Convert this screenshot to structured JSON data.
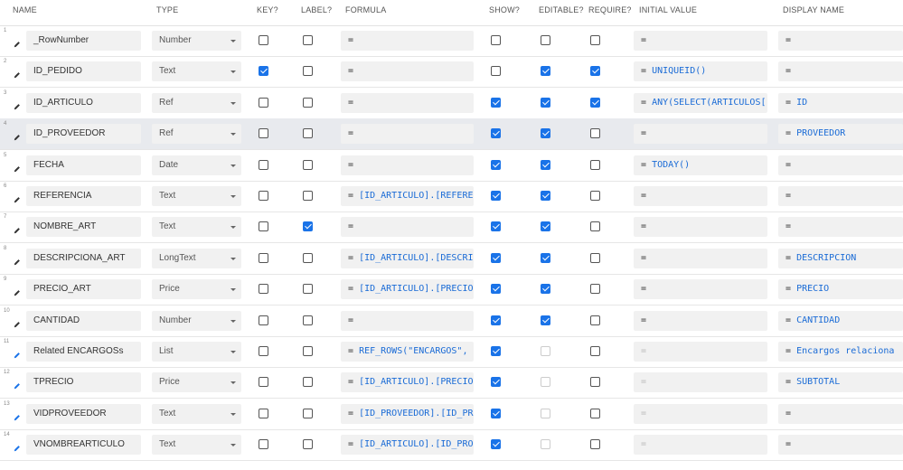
{
  "headers": {
    "name": "NAME",
    "type": "TYPE",
    "key": "KEY?",
    "label": "LABEL?",
    "formula": "FORMULA",
    "show": "SHOW?",
    "editable": "EDITABLE?",
    "require": "REQUIRE?",
    "initial": "INITIAL VALUE",
    "display": "DISPLAY NAME"
  },
  "colors": {
    "accent": "#1a73e8",
    "formula_text": "#1a6bd6",
    "highlight_row": "#e8eaee"
  },
  "rows": [
    {
      "num": "1",
      "name": "_RowNumber",
      "type": "Number",
      "key": false,
      "label": false,
      "formula": "",
      "show": false,
      "editable": false,
      "editable_disabled": false,
      "require": false,
      "initial": "",
      "initial_dim": false,
      "display": ""
    },
    {
      "num": "2",
      "name": "ID_PEDIDO",
      "type": "Text",
      "key": true,
      "label": false,
      "formula": "",
      "show": false,
      "editable": true,
      "editable_disabled": false,
      "require": true,
      "initial": "UNIQUEID()",
      "initial_dim": false,
      "display": ""
    },
    {
      "num": "3",
      "name": "ID_ARTICULO",
      "type": "Ref",
      "key": false,
      "label": false,
      "formula": "",
      "show": true,
      "editable": true,
      "editable_disabled": false,
      "require": true,
      "initial": "ANY(SELECT(ARTICULOS[",
      "initial_dim": false,
      "display": "ID"
    },
    {
      "num": "4",
      "name": "ID_PROVEEDOR",
      "type": "Ref",
      "key": false,
      "label": false,
      "formula": "",
      "show": true,
      "editable": true,
      "editable_disabled": false,
      "require": false,
      "initial": "",
      "initial_dim": false,
      "display": "PROVEEDOR"
    },
    {
      "num": "5",
      "name": "FECHA",
      "type": "Date",
      "key": false,
      "label": false,
      "formula": "",
      "show": true,
      "editable": true,
      "editable_disabled": false,
      "require": false,
      "initial": "TODAY()",
      "initial_dim": false,
      "display": ""
    },
    {
      "num": "6",
      "name": "REFERENCIA",
      "type": "Text",
      "key": false,
      "label": false,
      "formula": "[ID_ARTICULO].[REFERE",
      "show": true,
      "editable": true,
      "editable_disabled": false,
      "require": false,
      "initial": "",
      "initial_dim": false,
      "display": ""
    },
    {
      "num": "7",
      "name": "NOMBRE_ART",
      "type": "Text",
      "key": false,
      "label": true,
      "formula": "",
      "show": true,
      "editable": true,
      "editable_disabled": false,
      "require": false,
      "initial": "",
      "initial_dim": false,
      "display": ""
    },
    {
      "num": "8",
      "name": "DESCRIPCIONA_ART",
      "type": "LongText",
      "key": false,
      "label": false,
      "formula": "[ID_ARTICULO].[DESCRI",
      "show": true,
      "editable": true,
      "editable_disabled": false,
      "require": false,
      "initial": "",
      "initial_dim": false,
      "display": "DESCRIPCION"
    },
    {
      "num": "9",
      "name": "PRECIO_ART",
      "type": "Price",
      "key": false,
      "label": false,
      "formula": "[ID_ARTICULO].[PRECIO",
      "show": true,
      "editable": true,
      "editable_disabled": false,
      "require": false,
      "initial": "",
      "initial_dim": false,
      "display": "PRECIO"
    },
    {
      "num": "10",
      "name": "CANTIDAD",
      "type": "Number",
      "key": false,
      "label": false,
      "formula": "",
      "show": true,
      "editable": true,
      "editable_disabled": false,
      "require": false,
      "initial": "",
      "initial_dim": false,
      "display": "CANTIDAD"
    },
    {
      "num": "11",
      "name": "Related ENCARGOSs",
      "type": "List",
      "key": false,
      "label": false,
      "formula": "REF_ROWS(\"ENCARGOS\",",
      "show": true,
      "editable": false,
      "editable_disabled": true,
      "require": false,
      "initial": "",
      "initial_dim": true,
      "display": "Encargos relaciona"
    },
    {
      "num": "12",
      "name": "TPRECIO",
      "type": "Price",
      "key": false,
      "label": false,
      "formula": "[ID_ARTICULO].[PRECIO",
      "show": true,
      "editable": false,
      "editable_disabled": true,
      "require": false,
      "initial": "",
      "initial_dim": true,
      "display": "SUBTOTAL"
    },
    {
      "num": "13",
      "name": "VIDPROVEEDOR",
      "type": "Text",
      "key": false,
      "label": false,
      "formula": "[ID_PROVEEDOR].[ID_PR",
      "show": true,
      "editable": false,
      "editable_disabled": true,
      "require": false,
      "initial": "",
      "initial_dim": true,
      "display": ""
    },
    {
      "num": "14",
      "name": "VNOMBREARTICULO",
      "type": "Text",
      "key": false,
      "label": false,
      "formula": "[ID_ARTICULO].[ID_PRO",
      "show": true,
      "editable": false,
      "editable_disabled": true,
      "require": false,
      "initial": "",
      "initial_dim": true,
      "display": ""
    }
  ]
}
